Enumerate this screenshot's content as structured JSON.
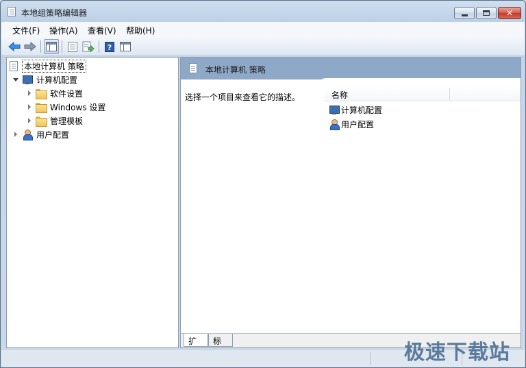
{
  "window": {
    "title": "本地组策略编辑器",
    "buttons": {
      "minimize": "minimize",
      "maximize": "maximize",
      "close": "close"
    }
  },
  "menu": [
    "文件(F)",
    "操作(A)",
    "查看(V)",
    "帮助(H)"
  ],
  "toolbar": {
    "icons": [
      "back-arrow-icon",
      "forward-arrow-icon",
      "show-hide-tree-icon",
      "properties-icon",
      "export-list-icon",
      "help-icon",
      "console-tree-icon"
    ]
  },
  "tree": {
    "root": "本地计算机 策略",
    "computer": "计算机配置",
    "software": "软件设置",
    "windows": "Windows 设置",
    "admin": "管理模板",
    "user": "用户配置"
  },
  "right": {
    "header_title": "本地计算机 策略",
    "description": "选择一个项目来查看它的描述。",
    "column_name": "名称",
    "items": [
      "计算机配置",
      "用户配置"
    ]
  },
  "tabs": [
    "扩展",
    "标准"
  ],
  "watermark": "极速下载站",
  "colors": {
    "header": "#8ea9c8",
    "window_frame": "#c9d9ea"
  }
}
